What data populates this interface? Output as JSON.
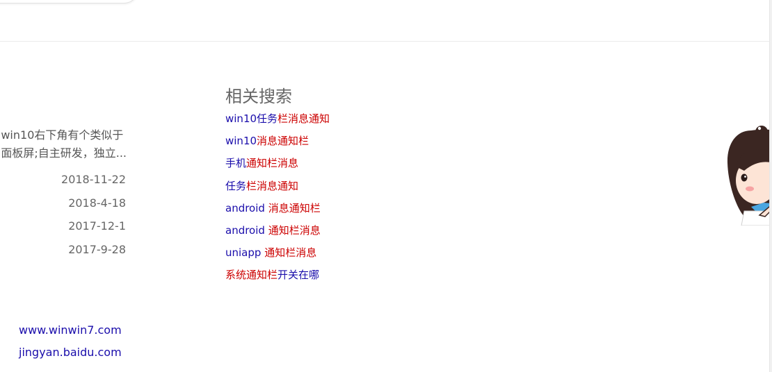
{
  "snippet": {
    "line1": "win10右下角有个类似于",
    "line2": "面板屏;自主研发，独立..."
  },
  "dates": [
    "2018-11-22",
    "2018-4-18",
    "2017-12-1",
    "2017-9-28"
  ],
  "domains": [
    "www.winwin7.com",
    "jingyan.baidu.com"
  ],
  "related": {
    "title": "相关搜索",
    "items": [
      {
        "blue": "win10任务",
        "red": "栏消息通知"
      },
      {
        "blue": "win10",
        "red": "消息通知栏"
      },
      {
        "blue": "手机",
        "red": "通知栏消息"
      },
      {
        "blue": "任务",
        "red": "栏消息通知"
      },
      {
        "blue": "android ",
        "red": "消息通知栏"
      },
      {
        "blue": "android ",
        "red": "通知栏消息"
      },
      {
        "blue": "uniapp ",
        "red": "通知栏消息"
      },
      {
        "red": "系统通知栏",
        "blue": "开关在哪"
      }
    ]
  },
  "colors": {
    "link_blue": "#1a0dab",
    "highlight_red": "#cc0000",
    "text_gray": "#666666"
  },
  "icons": {
    "mascot": "cartoon-girl-mascot"
  }
}
